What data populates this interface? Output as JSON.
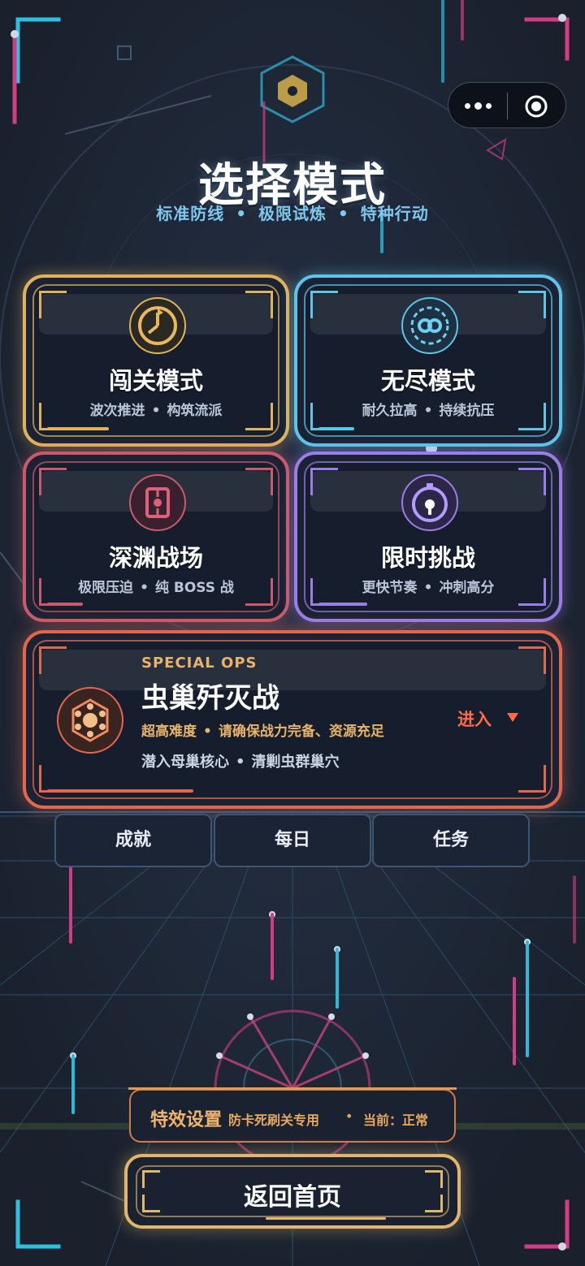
{
  "header": {
    "title": "选择模式",
    "subtitle": [
      "标准防线",
      "极限试炼",
      "特种行动"
    ],
    "separator": "•"
  },
  "capsule": {
    "menu_icon": "more-dots-icon",
    "close_icon": "target-close-icon"
  },
  "modes": [
    {
      "name": "闯关模式",
      "desc": [
        "波次推进",
        "构筑流派"
      ],
      "icon": "flag-clock-icon",
      "accent": "#e1b25c"
    },
    {
      "name": "无尽模式",
      "desc": [
        "耐久拉高",
        "持续抗压"
      ],
      "icon": "infinity-orbit-icon",
      "accent": "#5ec4e8"
    },
    {
      "name": "深渊战场",
      "desc": [
        "极限压迫",
        "纯 BOSS 战"
      ],
      "icon": "abyss-core-icon",
      "accent": "#c95a6b"
    },
    {
      "name": "限时挑战",
      "desc": [
        "更快节奏",
        "冲刺高分"
      ],
      "icon": "stopwatch-icon",
      "accent": "#9b7de6"
    }
  ],
  "special": {
    "tag": "SPECIAL OPS",
    "name": "虫巢歼灭战",
    "warning": [
      "超高难度",
      "请确保战力完备、资源充足"
    ],
    "goal": [
      "潜入母巢核心",
      "清剿虫群巢穴"
    ],
    "enter": "进入",
    "icon": "hive-core-icon",
    "accent": "#e2674f"
  },
  "tabs": [
    "成就",
    "每日",
    "任务"
  ],
  "effects": {
    "label": "特效设置",
    "hint": "防卡死刷关专用",
    "separator": "•",
    "status": "当前：正常"
  },
  "home_button": "返回首页"
}
